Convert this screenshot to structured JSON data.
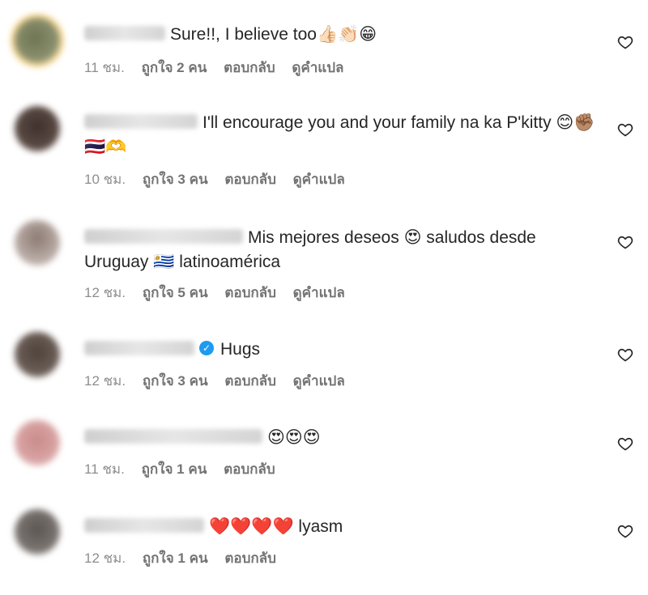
{
  "comments": [
    {
      "text": "Sure!!, I believe too👍🏻👏🏻😁",
      "time": "11 ชม.",
      "likes": "ถูกใจ 2 คน",
      "reply": "ตอบกลับ",
      "translate": "ดูคำแปล",
      "avatar_color": "#8a8f6e",
      "verified": false
    },
    {
      "text": "I'll encourage you and your family na ka P'kitty 😊✊🏽🇹🇭🫶",
      "time": "10 ชม.",
      "likes": "ถูกใจ 3 คน",
      "reply": "ตอบกลับ",
      "translate": "ดูคำแปล",
      "avatar_color": "#5a4a44",
      "verified": false
    },
    {
      "text": "Mis mejores deseos 😍 saludos desde Uruguay 🇺🇾 latinoamérica",
      "time": "12 ชม.",
      "likes": "ถูกใจ 5 คน",
      "reply": "ตอบกลับ",
      "translate": "ดูคำแปล",
      "avatar_color": "#b8aaa4",
      "verified": false
    },
    {
      "text": "Hugs",
      "time": "12 ชม.",
      "likes": "ถูกใจ 3 คน",
      "reply": "ตอบกลับ",
      "translate": "ดูคำแปล",
      "avatar_color": "#6b5d56",
      "verified": true
    },
    {
      "text": "😍😍😍",
      "time": "11 ชม.",
      "likes": "ถูกใจ 1 คน",
      "reply": "ตอบกลับ",
      "translate": "",
      "avatar_color": "#d9a4a4",
      "verified": false
    },
    {
      "text": "❤️❤️❤️❤️ lyasm",
      "time": "12 ชม.",
      "likes": "ถูกใจ 1 คน",
      "reply": "ตอบกลับ",
      "translate": "",
      "avatar_color": "#7a7470",
      "verified": false
    }
  ]
}
